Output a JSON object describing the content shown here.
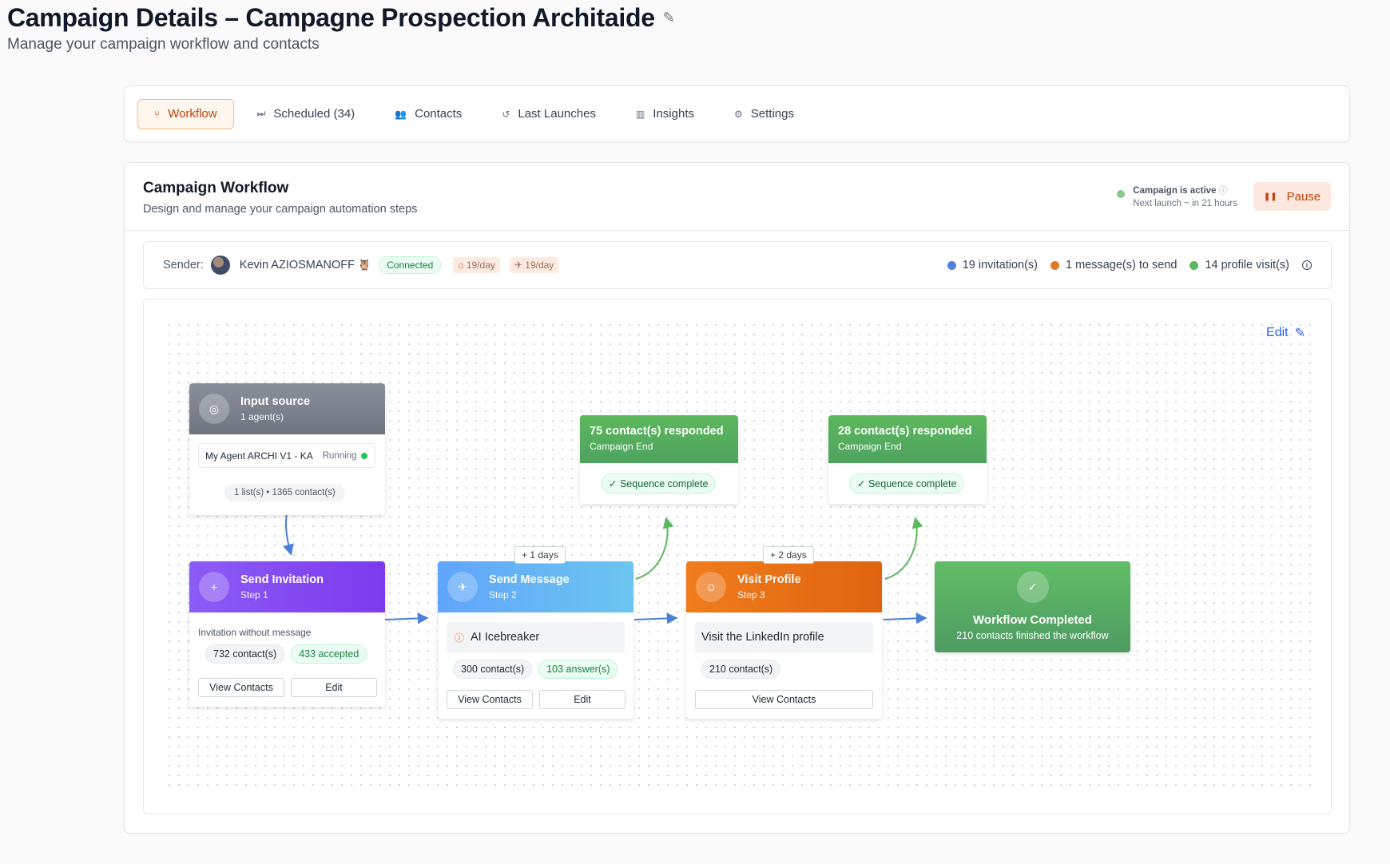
{
  "header": {
    "title": "Campaign Details – Campagne Prospection Architaide",
    "subtitle": "Manage your campaign workflow and contacts",
    "edit_icon": "pencil-icon"
  },
  "tabs": [
    {
      "label": "Workflow",
      "icon": "branch-icon",
      "active": true
    },
    {
      "label": "Scheduled (34)",
      "icon": "skip-forward-icon",
      "active": false
    },
    {
      "label": "Contacts",
      "icon": "users-icon",
      "active": false
    },
    {
      "label": "Last Launches",
      "icon": "history-icon",
      "active": false
    },
    {
      "label": "Insights",
      "icon": "chart-icon",
      "active": false
    },
    {
      "label": "Settings",
      "icon": "gear-icon",
      "active": false
    }
  ],
  "workflow": {
    "title": "Campaign Workflow",
    "subtitle": "Design and manage your campaign automation steps",
    "status_title": "Campaign is active",
    "status_next": "Next launch ~ in 21 hours",
    "pause_label": "Pause",
    "edit_label": "Edit"
  },
  "sender": {
    "label": "Sender:",
    "name": "Kevin AZIOSMANOFF",
    "connected": "Connected",
    "limit1": "19/day",
    "limit2": "19/day",
    "stats": [
      {
        "label": "19 invitation(s)",
        "color": "#4f7fe0"
      },
      {
        "label": "1 message(s) to send",
        "color": "#e07b24"
      },
      {
        "label": "14 profile visit(s)",
        "color": "#5cb85c"
      }
    ]
  },
  "nodes": {
    "input": {
      "title": "Input source",
      "sub": "1 agent(s)",
      "agent": "My Agent ARCHI V1 - KA",
      "agent_status": "Running",
      "lists": "1 list(s) • 1365 contact(s)"
    },
    "invite": {
      "title": "Send Invitation",
      "sub": "Step 1",
      "desc": "Invitation without message",
      "contacts": "732 contact(s)",
      "accepted": "433 accepted",
      "view": "View Contacts",
      "edit": "Edit"
    },
    "message": {
      "title": "Send Message",
      "sub": "Step 2",
      "feature": "AI Icebreaker",
      "contacts": "300 contact(s)",
      "answers": "103 answer(s)",
      "view": "View Contacts",
      "edit": "Edit"
    },
    "visit": {
      "title": "Visit Profile",
      "sub": "Step 3",
      "desc": "Visit the LinkedIn profile",
      "contacts": "210 contact(s)",
      "view": "View Contacts"
    },
    "resp1": {
      "title": "75 contact(s) responded",
      "sub": "Campaign End",
      "seq": "✓ Sequence complete"
    },
    "resp2": {
      "title": "28 contact(s) responded",
      "sub": "Campaign End",
      "seq": "✓ Sequence complete"
    },
    "done": {
      "title": "Workflow Completed",
      "sub": "210 contacts finished the workflow"
    },
    "delay1": "+ 1 days",
    "delay2": "+ 2 days"
  }
}
